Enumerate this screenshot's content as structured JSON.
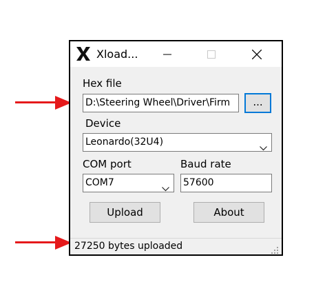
{
  "window": {
    "title": "Xload...",
    "icon": "x-logo-icon",
    "controls": {
      "minimize": "minimize-icon",
      "maximize": "maximize-icon",
      "close": "close-icon"
    }
  },
  "hex_file": {
    "label": "Hex file",
    "value": "D:\\Steering Wheel\\Driver\\Firm",
    "browse_label": "..."
  },
  "device": {
    "label": "Device",
    "selected": "Leonardo(32U4)"
  },
  "com_port": {
    "label": "COM port",
    "selected": "COM7"
  },
  "baud_rate": {
    "label": "Baud rate",
    "value": "57600"
  },
  "buttons": {
    "upload": "Upload",
    "about": "About"
  },
  "status": {
    "text": "27250 bytes uploaded"
  },
  "annotations": {
    "arrow_color": "#e5191b"
  }
}
